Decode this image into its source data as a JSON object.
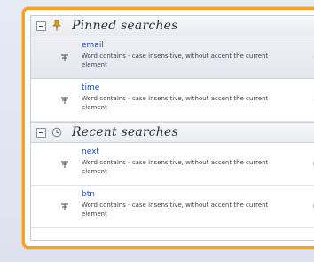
{
  "pinned": {
    "title": "Pinned searches",
    "items": [
      {
        "name": "email",
        "description": "Word contains - case insensitive, without accent the current element"
      },
      {
        "name": "time",
        "description": "Word contains - case insensitive, without accent the current element"
      }
    ]
  },
  "recent": {
    "title": "Recent searches",
    "items": [
      {
        "name": "next",
        "description": "Word contains - case insensitive, without accent the current element"
      },
      {
        "name": "btn",
        "description": "Word contains - case insensitive, without accent the current element"
      }
    ]
  },
  "icons": {
    "group_toggle": "collapse-minus-icon",
    "pinned_group": "pin-icon",
    "recent_group": "clock-icon",
    "search_type": "text-search-icon",
    "pin_action": "pin-icon",
    "recent_action": "clock-icon"
  },
  "colors": {
    "frame_border": "#f0a22b",
    "link_text": "#1f4fa8",
    "pin": "#e0a21c"
  }
}
